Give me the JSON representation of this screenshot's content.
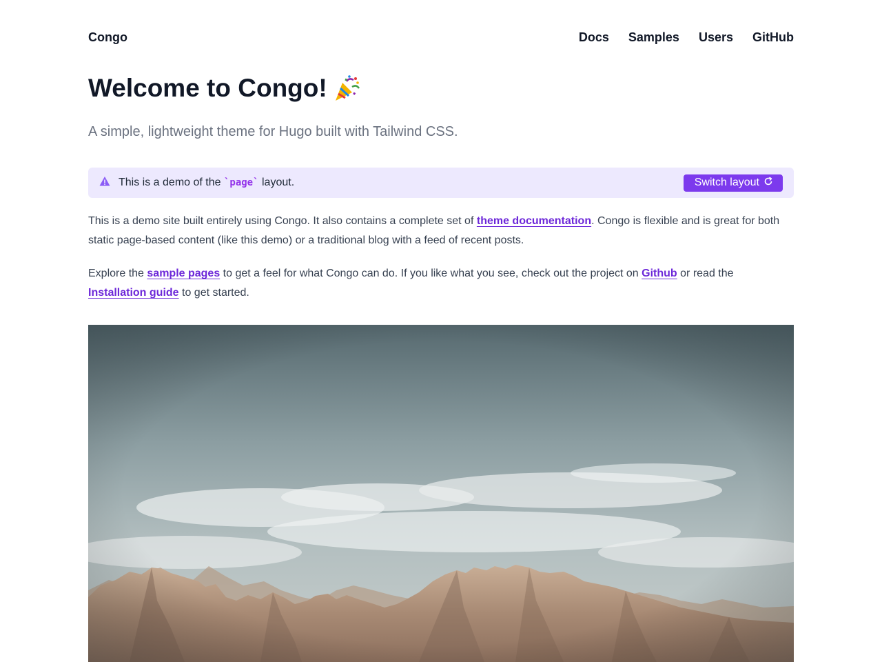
{
  "header": {
    "site_title": "Congo",
    "nav": [
      "Docs",
      "Samples",
      "Users",
      "GitHub"
    ]
  },
  "hero": {
    "title": "Welcome to Congo!",
    "emoji_icon": "party-popper-icon",
    "subtitle": "A simple, lightweight theme for Hugo built with Tailwind CSS."
  },
  "alert": {
    "icon": "warning-triangle-icon",
    "text_before": "This is a demo of the",
    "code": "`page`",
    "text_after": "layout.",
    "button_label": "Switch layout",
    "button_icon": "refresh-icon",
    "colors": {
      "background": "#ede9fe",
      "button": "#7c3aed"
    }
  },
  "content": {
    "p1": {
      "t1": "This is a demo site built entirely using Congo. It also contains a complete set of",
      "link1": "theme documentation",
      "t2": ". Congo is flexible and is great for both static page-based content (like this demo) or a traditional blog with a feed of recent posts."
    },
    "p2": {
      "t1": "Explore the",
      "link1": "sample pages",
      "t2": "to get a feel for what Congo can do. If you like what you see, check out the project on",
      "link2": "Github",
      "t3": "or read the",
      "link3": "Installation guide",
      "t4": "to get started."
    },
    "link_color": "#6d28d9"
  },
  "image": {
    "subject": "mountain-landscape-image"
  }
}
